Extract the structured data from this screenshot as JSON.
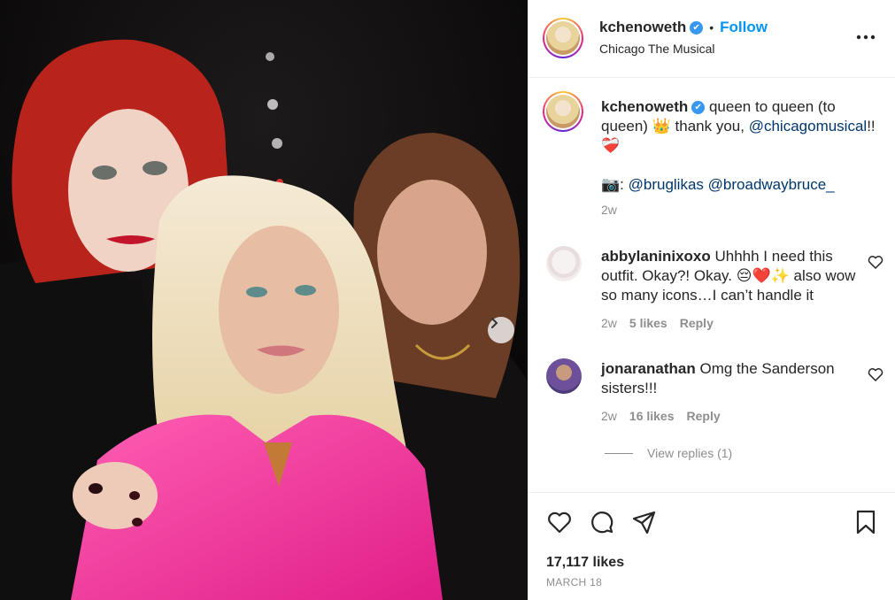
{
  "header": {
    "username": "kchenoweth",
    "verified": "✔",
    "dot": "•",
    "follow_label": "Follow",
    "location": "Chicago The Musical"
  },
  "caption": {
    "username": "kchenoweth",
    "text_1": " queen to queen (to queen) 👑 thank you, ",
    "mention_1": "@chicagomusical",
    "text_2": "!! ❤️‍🩹",
    "camera": "📷: ",
    "mention_2": "@bruglikas",
    "mention_3": "@broadwaybruce_",
    "time": "2w"
  },
  "comments": [
    {
      "username": "abbylaninixoxo",
      "text": " Uhhhh I need this outfit. Okay?! Okay. 😔❤️✨ also wow so many icons…I can’t handle it",
      "time": "2w",
      "likes": "5 likes",
      "reply": "Reply"
    },
    {
      "username": "jonaranathan",
      "text": " Omg the Sanderson sisters!!!",
      "time": "2w",
      "likes": "16 likes",
      "reply": "Reply"
    }
  ],
  "view_replies": "View replies (1)",
  "footer": {
    "likes": "17,117 likes",
    "date": "MARCH 18"
  },
  "icons": [
    "more-icon",
    "heart-icon",
    "comment-icon",
    "share-icon",
    "bookmark-icon",
    "chevron-right-icon",
    "verified-badge"
  ],
  "colors": {
    "follow": "#0095f6",
    "link": "#00376b",
    "muted": "#8e8e8e",
    "verified": "#3897f0"
  }
}
